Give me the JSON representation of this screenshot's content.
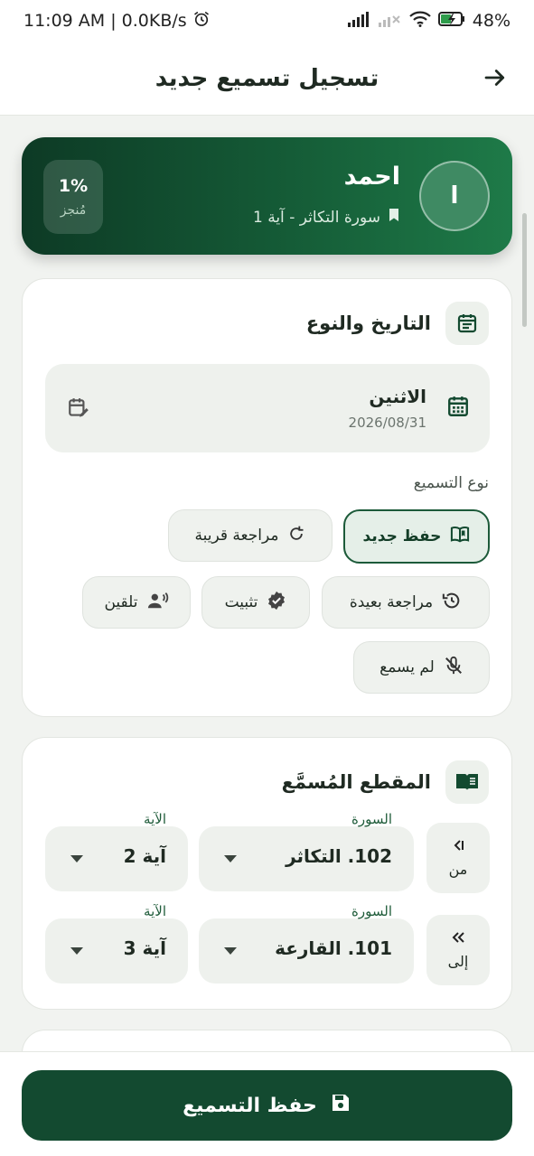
{
  "status_bar": {
    "time_speed": "11:09 AM | 0.0KB/s",
    "battery": "48%"
  },
  "app_bar": {
    "title": "تسجيل تسميع جديد"
  },
  "student": {
    "avatar_initial": "ا",
    "name": "احمد",
    "position": "سورة التكاثر - آية 1",
    "progress_value": "1%",
    "progress_label": "مُنجز"
  },
  "date_type_section": {
    "title": "التاريخ والنوع",
    "day": "الاثنين",
    "date": "2026/08/31",
    "type_label": "نوع التسميع",
    "types": [
      {
        "label": "حفظ جديد",
        "icon": "open-book-icon",
        "selected": true
      },
      {
        "label": "مراجعة قريبة",
        "icon": "refresh-icon",
        "selected": false
      },
      {
        "label": "مراجعة بعيدة",
        "icon": "history-icon",
        "selected": false
      },
      {
        "label": "تثبيت",
        "icon": "verified-badge-icon",
        "selected": false
      },
      {
        "label": "تلقين",
        "icon": "voice-person-icon",
        "selected": false
      },
      {
        "label": "لم يسمع",
        "icon": "mic-off-icon",
        "selected": false
      }
    ]
  },
  "segment_section": {
    "title": "المقطع المُسمَّع",
    "from": {
      "badge": "من",
      "surah_label": "السورة",
      "surah_value": "102. التكاثر",
      "ayah_label": "الآية",
      "ayah_value": "آية 2"
    },
    "to": {
      "badge": "إلى",
      "surah_label": "السورة",
      "surah_value": "101. القارعة",
      "ayah_label": "الآية",
      "ayah_value": "آية 3"
    }
  },
  "save_button": {
    "label": "حفظ التسميع"
  },
  "colors": {
    "primary": "#134a30",
    "hero_start": "#0d3a25",
    "hero_end": "#1e7a48",
    "background": "#f1f3f0"
  }
}
